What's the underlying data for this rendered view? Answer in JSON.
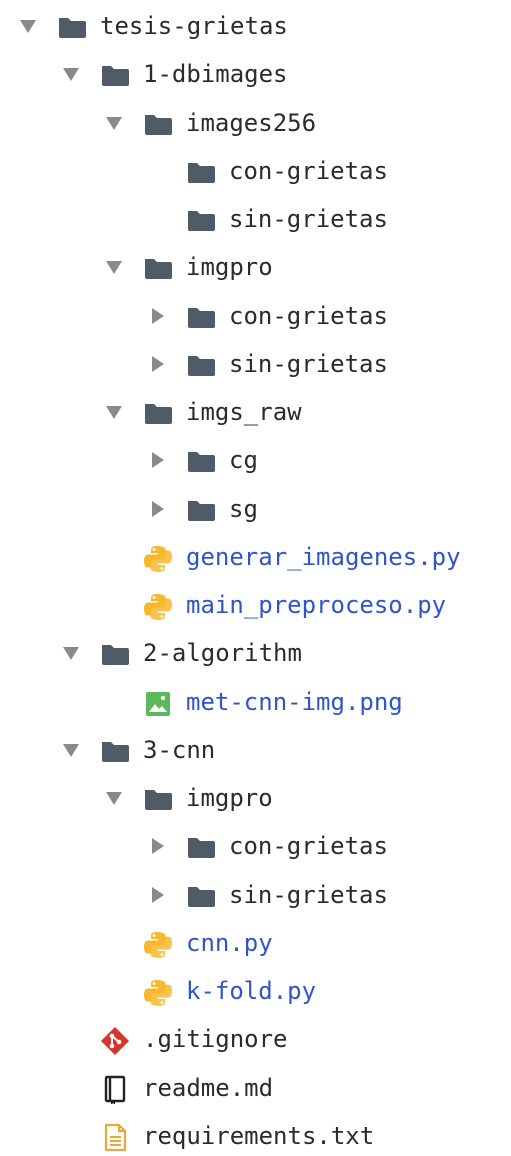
{
  "tree": [
    {
      "label": "tesis-grietas",
      "type": "folder",
      "depth": 0,
      "arrow": "expanded"
    },
    {
      "label": "1-dbimages",
      "type": "folder",
      "depth": 1,
      "arrow": "expanded"
    },
    {
      "label": "images256",
      "type": "folder",
      "depth": 2,
      "arrow": "expanded"
    },
    {
      "label": "con-grietas",
      "type": "folder",
      "depth": 3,
      "arrow": "none"
    },
    {
      "label": "sin-grietas",
      "type": "folder",
      "depth": 3,
      "arrow": "none"
    },
    {
      "label": "imgpro",
      "type": "folder",
      "depth": 2,
      "arrow": "expanded"
    },
    {
      "label": "con-grietas",
      "type": "folder",
      "depth": 3,
      "arrow": "collapsed"
    },
    {
      "label": "sin-grietas",
      "type": "folder",
      "depth": 3,
      "arrow": "collapsed"
    },
    {
      "label": "imgs_raw",
      "type": "folder",
      "depth": 2,
      "arrow": "expanded"
    },
    {
      "label": "cg",
      "type": "folder",
      "depth": 3,
      "arrow": "collapsed"
    },
    {
      "label": "sg",
      "type": "folder",
      "depth": 3,
      "arrow": "collapsed"
    },
    {
      "label": "generar_imagenes.py",
      "type": "python",
      "depth": 2,
      "arrow": "none"
    },
    {
      "label": "main_preproceso.py",
      "type": "python",
      "depth": 2,
      "arrow": "none"
    },
    {
      "label": "2-algorithm",
      "type": "folder",
      "depth": 1,
      "arrow": "expanded"
    },
    {
      "label": "met-cnn-img.png",
      "type": "image",
      "depth": 2,
      "arrow": "none"
    },
    {
      "label": "3-cnn",
      "type": "folder",
      "depth": 1,
      "arrow": "expanded"
    },
    {
      "label": "imgpro",
      "type": "folder",
      "depth": 2,
      "arrow": "expanded"
    },
    {
      "label": "con-grietas",
      "type": "folder",
      "depth": 3,
      "arrow": "collapsed"
    },
    {
      "label": "sin-grietas",
      "type": "folder",
      "depth": 3,
      "arrow": "collapsed"
    },
    {
      "label": "cnn.py",
      "type": "python",
      "depth": 2,
      "arrow": "none"
    },
    {
      "label": "k-fold.py",
      "type": "python",
      "depth": 2,
      "arrow": "none"
    },
    {
      "label": ".gitignore",
      "type": "git",
      "depth": 1,
      "arrow": "none"
    },
    {
      "label": "readme.md",
      "type": "markdown",
      "depth": 1,
      "arrow": "none"
    },
    {
      "label": "requirements.txt",
      "type": "text",
      "depth": 1,
      "arrow": "none"
    }
  ],
  "colors": {
    "folder": "#4f5b66",
    "arrow": "#8a8a8a",
    "python_blue": "#3a6ea5",
    "python_yellow": "#f5b82e",
    "image_green": "#5cb85c",
    "git_red": "#d9342b",
    "text_doc": "#e8a93a",
    "link_text": "#2f55c8",
    "plain_text": "#2b2b2b"
  }
}
